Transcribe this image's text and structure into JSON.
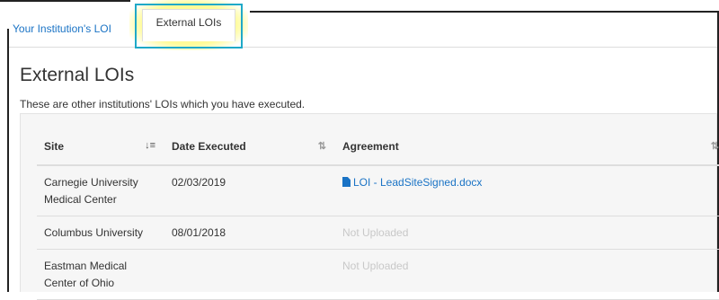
{
  "tabs": {
    "institution": "Your Institution's LOI",
    "external": "External LOIs"
  },
  "page": {
    "title": "External LOIs",
    "subtitle": "These are other institutions' LOIs which you have executed."
  },
  "table": {
    "headers": {
      "site": "Site",
      "date": "Date Executed",
      "agreement": "Agreement"
    },
    "rows": [
      {
        "site": "Carnegie University Medical Center",
        "date": "02/03/2019",
        "agreement": "LOI - LeadSiteSigned.docx",
        "agreement_uploaded": true
      },
      {
        "site": "Columbus University",
        "date": "08/01/2018",
        "agreement": "Not Uploaded",
        "agreement_uploaded": false
      },
      {
        "site": "Eastman Medical Center of Ohio",
        "date": "",
        "agreement": "Not Uploaded",
        "agreement_uploaded": false
      }
    ]
  },
  "icons": {
    "sort_active": "sort-amount-icon",
    "sort": "sort-arrows-icon",
    "document": "file-icon"
  },
  "colors": {
    "link": "#1a73c5",
    "highlight": "#fffa78",
    "focus_border": "#1fa9c8",
    "muted": "#c8c8c8"
  }
}
